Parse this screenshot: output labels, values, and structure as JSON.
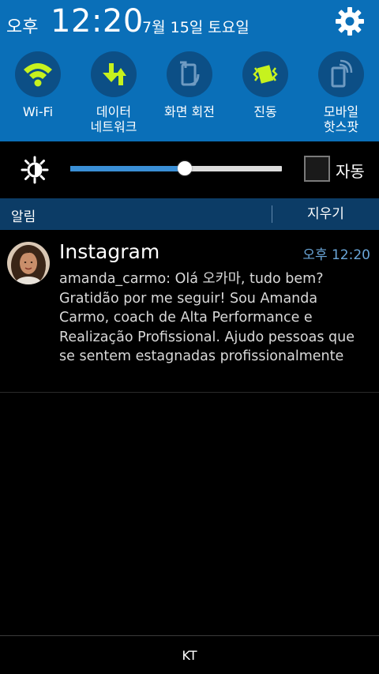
{
  "status": {
    "ampm": "오후",
    "time": "12:20",
    "date": "7월 15일 토요일"
  },
  "quick_toggles": [
    {
      "label": "Wi-Fi",
      "icon": "wifi-icon"
    },
    {
      "label": "데이터\n네트워크",
      "icon": "data-network-icon"
    },
    {
      "label": "화면 회전",
      "icon": "screen-rotation-icon"
    },
    {
      "label": "진동",
      "icon": "vibrate-icon"
    },
    {
      "label": "모바일\n핫스팟",
      "icon": "mobile-hotspot-icon"
    }
  ],
  "brightness": {
    "level": 0.54,
    "auto_label": "자동",
    "auto_checked": false
  },
  "notifications_header": {
    "title": "알림",
    "clear_label": "지우기"
  },
  "notification": {
    "app": "Instagram",
    "time": "오후 12:20",
    "body": "amanda_carmo: Olá 오카마, tudo bem? Gratidão por me seguir! Sou Amanda Carmo, coach de Alta Performance e Realização Profissional. Ajudo pessoas que se sentem estagnadas profissionalmente"
  },
  "carrier": "KT",
  "colors": {
    "panel_blue": "#0a6fb8",
    "toggle_circle": "#0c4f86",
    "active_icon": "#c6f21e",
    "header_blue": "#0c3c66",
    "time_blue": "#6aa6d8"
  }
}
